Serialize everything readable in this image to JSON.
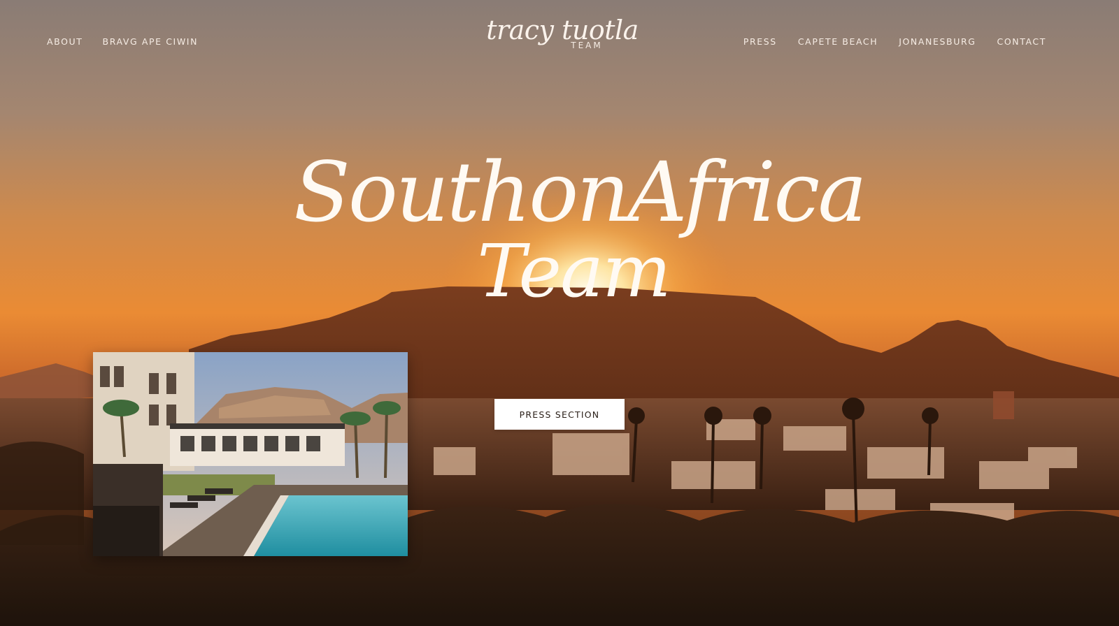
{
  "nav": {
    "left": [
      {
        "label": "ABOUT"
      },
      {
        "label": "BRAVG APE CIWIN"
      }
    ],
    "right": [
      {
        "label": "PRESS"
      },
      {
        "label": "CAPETE BEACH"
      },
      {
        "label": "JONANESBURG"
      },
      {
        "label": "CONTACT"
      }
    ]
  },
  "logo": {
    "script": "tracy tuotla",
    "sub": "TEAM"
  },
  "hero": {
    "headline_line1": "SouthonAfrica",
    "headline_line2": "Team",
    "cta_label": "PRESS SECTION"
  },
  "colors": {
    "sky_top": "#8b7b73",
    "sky_mid": "#d58a47",
    "sky_glow": "#f7a23a",
    "mountain": "#6a341c",
    "text": "#fffaf3",
    "cta_bg": "#ffffff",
    "cta_text": "#2b2019"
  }
}
